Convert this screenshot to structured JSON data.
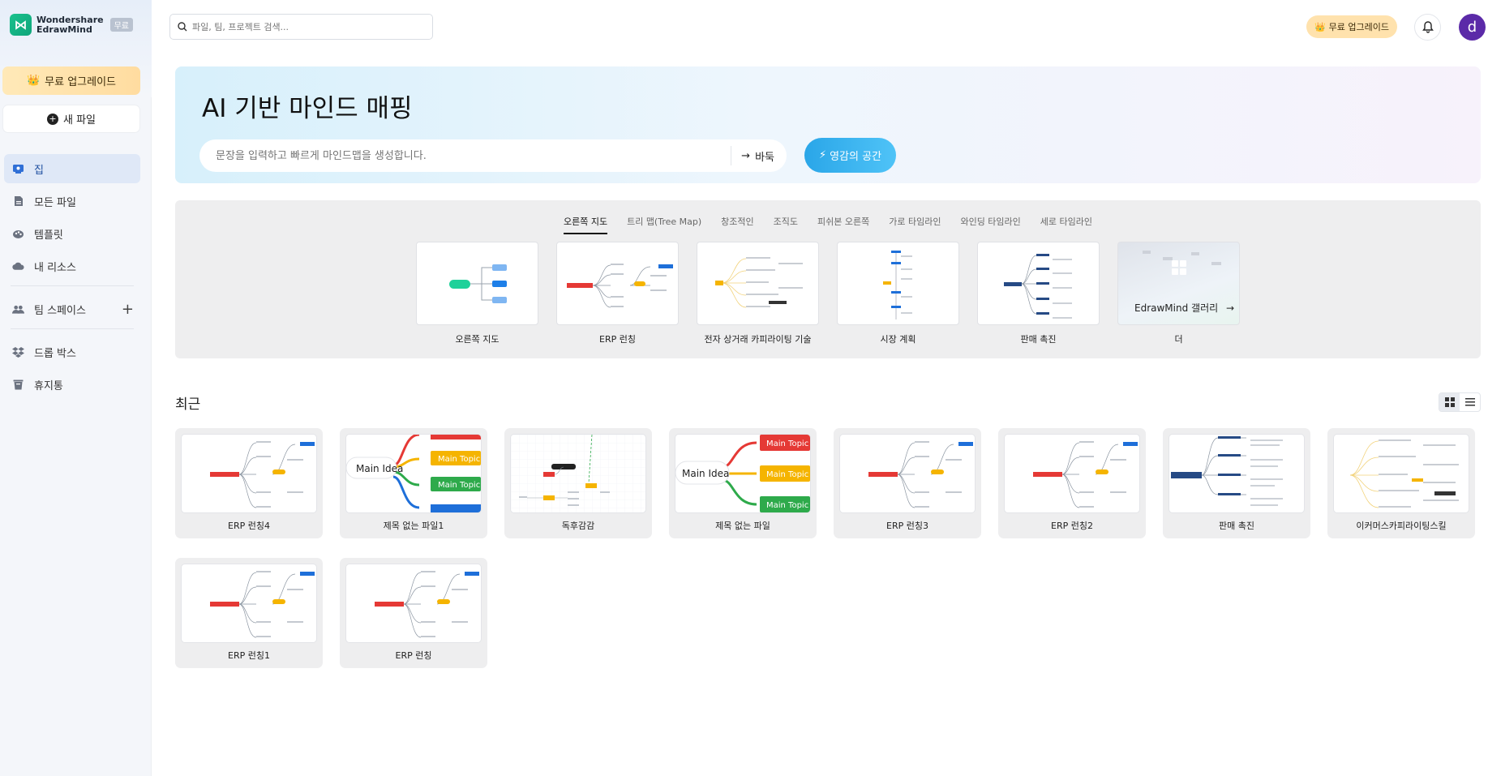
{
  "app": {
    "brand_line1": "Wondershare",
    "brand_line2": "EdrawMind",
    "plan_badge": "무료"
  },
  "sidebar": {
    "upgrade_label": "무료 업그레이드",
    "new_file_label": "새 파일",
    "items": [
      {
        "label": "집",
        "icon": "home-icon",
        "active": true
      },
      {
        "label": "모든 파일",
        "icon": "file-icon"
      },
      {
        "label": "템플릿",
        "icon": "template-icon"
      },
      {
        "label": "내 리소스",
        "icon": "cloud-icon"
      }
    ],
    "team_space_label": "팀 스페이스",
    "bottom_items": [
      {
        "label": "드롭 박스",
        "icon": "dropbox-icon"
      },
      {
        "label": "휴지통",
        "icon": "trash-icon"
      }
    ]
  },
  "topbar": {
    "search_placeholder": "파일, 팀, 프로젝트 검색...",
    "upgrade_label": "무료 업그레이드",
    "avatar_initial": "d"
  },
  "ai_banner": {
    "title": "AI 기반 마인드 매핑",
    "input_placeholder": "문장을 입력하고 빠르게 마인드맵을 생성합니다.",
    "go_label": "바둑",
    "inspire_label": "영감의 공간"
  },
  "templates": {
    "tabs": [
      "오른쪽 지도",
      "트리 맵(Tree Map)",
      "창조적인",
      "조직도",
      "피쉬본 오른쪽",
      "가로 타임라인",
      "와인딩 타임라인",
      "세로 타임라인"
    ],
    "active_tab": 0,
    "cards": [
      {
        "label": "오른쪽 지도"
      },
      {
        "label": "ERP 런칭"
      },
      {
        "label": "전자 상거래 카피라이팅 기술"
      },
      {
        "label": "시장 계획"
      },
      {
        "label": "판매 촉진"
      },
      {
        "label": "더"
      }
    ],
    "gallery_label": "EdrawMind 갤러리"
  },
  "recent": {
    "title": "최근",
    "files": [
      {
        "label": "ERP 런칭4",
        "thumb": "erp"
      },
      {
        "label": "제목 없는 파일1",
        "thumb": "main1"
      },
      {
        "label": "독후감감",
        "thumb": "book"
      },
      {
        "label": "제목 없는 파일",
        "thumb": "main2"
      },
      {
        "label": "ERP 런칭3",
        "thumb": "erp"
      },
      {
        "label": "ERP 런칭2",
        "thumb": "erp"
      },
      {
        "label": "판매 촉진",
        "thumb": "sales"
      },
      {
        "label": "이커머스카피라이팅스킬",
        "thumb": "ecom"
      },
      {
        "label": "ERP 런칭1",
        "thumb": "erp"
      },
      {
        "label": "ERP 런칭",
        "thumb": "erp"
      }
    ],
    "thumb_text": {
      "main_idea": "Main Idea",
      "main_topic": "Main Topic"
    }
  },
  "colors": {
    "accent_blue": "#2aa6e8",
    "red_topic": "#e53935",
    "orange_topic": "#f5b400",
    "green_topic": "#2eaa4b",
    "blue_topic": "#1e6fd9"
  }
}
